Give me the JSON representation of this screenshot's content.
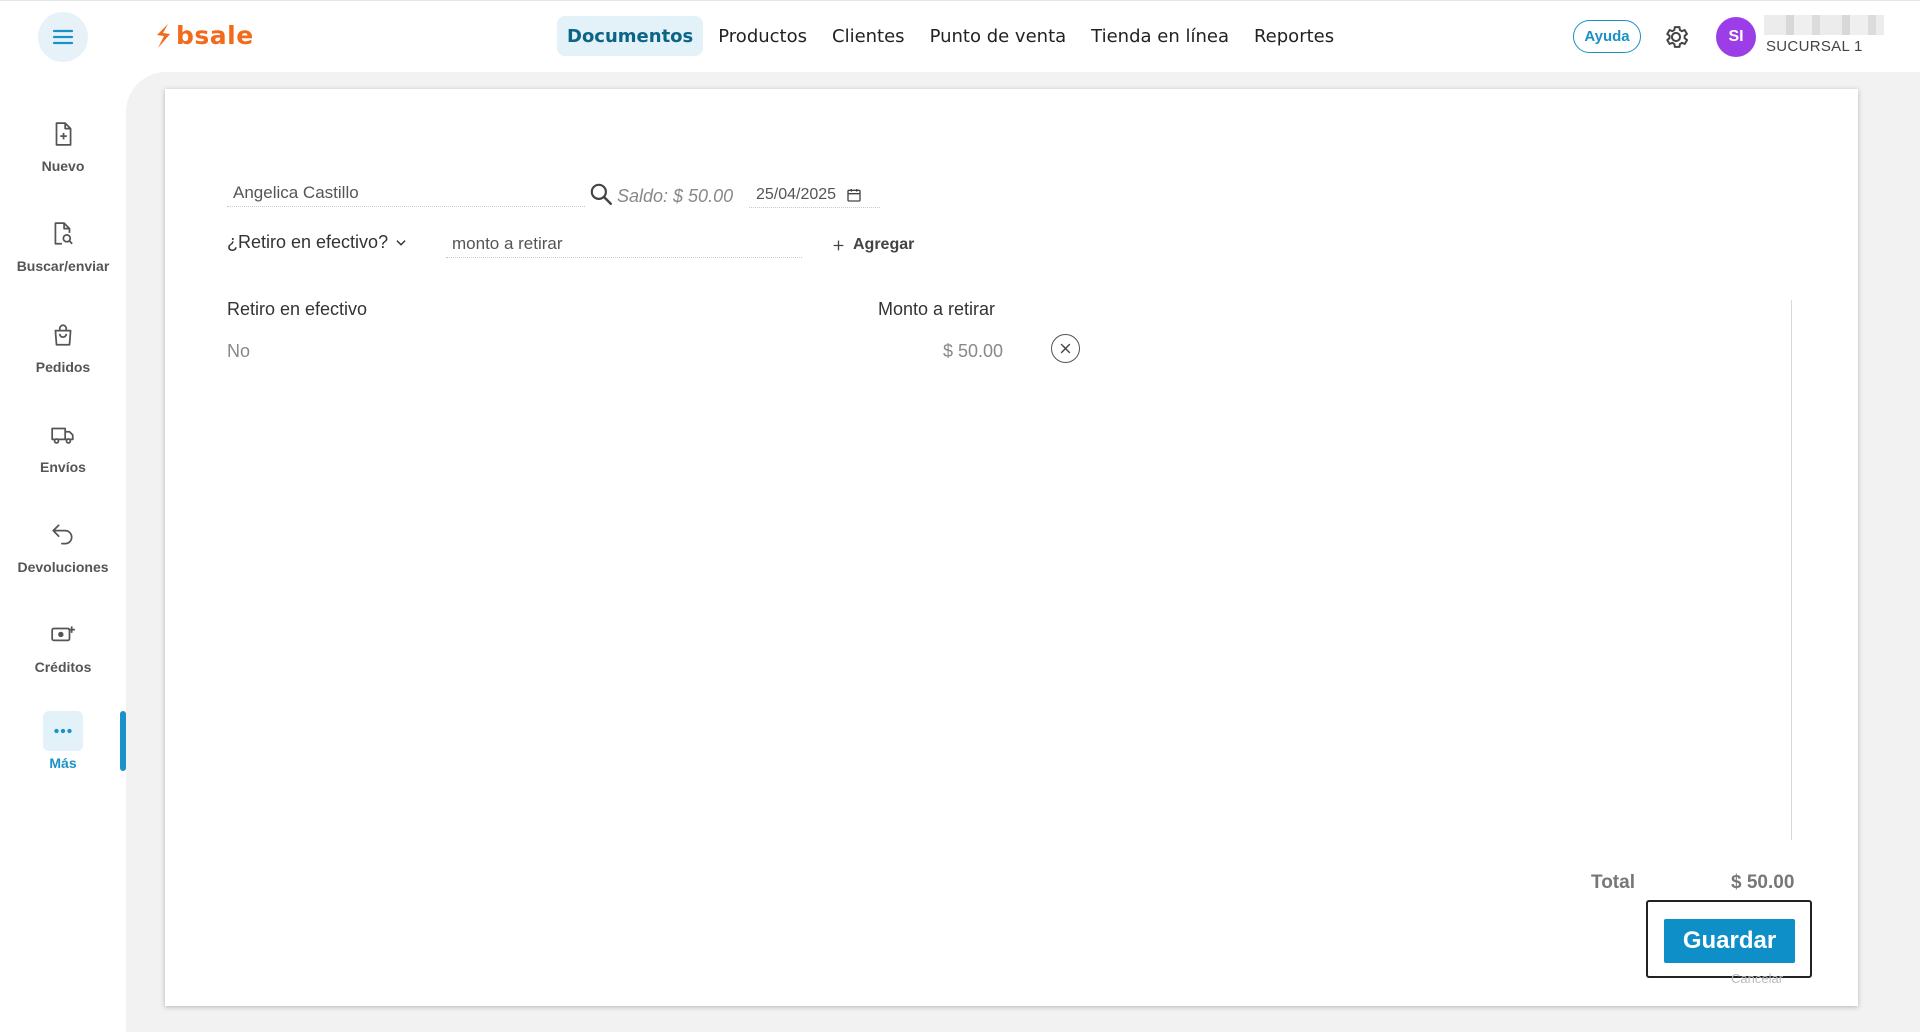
{
  "header": {
    "logo_text": "bsale",
    "nav": [
      "Documentos",
      "Productos",
      "Clientes",
      "Punto de venta",
      "Tienda en línea",
      "Reportes"
    ],
    "active_nav": "Documentos",
    "help_label": "Ayuda",
    "avatar_initials": "SI",
    "branch_label": "SUCURSAL 1"
  },
  "sidebar": {
    "items": [
      {
        "label": "Nuevo",
        "icon": "file-plus-icon"
      },
      {
        "label": "Buscar/enviar",
        "icon": "file-search-icon"
      },
      {
        "label": "Pedidos",
        "icon": "bag-icon"
      },
      {
        "label": "Envíos",
        "icon": "truck-icon"
      },
      {
        "label": "Devoluciones",
        "icon": "return-arrow-icon"
      },
      {
        "label": "Créditos",
        "icon": "money-plus-icon"
      },
      {
        "label": "Más",
        "icon": "more-dots-icon"
      }
    ],
    "active": "Más"
  },
  "form": {
    "client_value": "Angelica Castillo",
    "saldo_text": "Saldo: $ 50.00",
    "date_value": "25/04/2025",
    "withdraw_dropdown": "¿Retiro en efectivo?",
    "amount_placeholder": "monto a retirar",
    "add_label": "Agregar"
  },
  "table": {
    "headers": [
      "Retiro en efectivo",
      "Monto a retirar"
    ],
    "rows": [
      {
        "retiro": "No",
        "monto": "$ 50.00"
      }
    ]
  },
  "footer": {
    "total_label": "Total",
    "total_value": "$ 50.00",
    "save_label": "Guardar",
    "cancel_label": "Cancelar"
  },
  "colors": {
    "brand": "#f26a1b",
    "accent": "#1a91c7",
    "avatar": "#9b3ee8"
  }
}
